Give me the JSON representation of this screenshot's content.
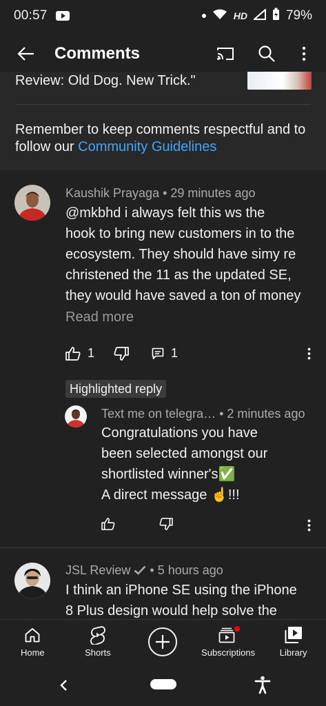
{
  "status_bar": {
    "time": "00:57",
    "network": "HD",
    "battery": "79%"
  },
  "app_bar": {
    "title": "Comments",
    "icons": [
      "back-arrow-icon",
      "cast-icon",
      "search-icon",
      "more-vert-icon"
    ]
  },
  "video": {
    "title": "Review: Old Dog. New Trick.\""
  },
  "guidelines": {
    "text": "Remember to keep comments respectful and to follow our ",
    "link": "Community Guidelines"
  },
  "comments": [
    {
      "author": "Kaushik Prayaga",
      "time": "29 minutes ago",
      "lines": [
        "@mkbhd i always felt this ws the",
        "hook to bring new customers in to the",
        "ecosystem. They should have simy re",
        "christened the 11 as the updated SE,",
        "they would have saved a ton of money"
      ],
      "read_more": "Read more",
      "likes": "1",
      "replies": "1"
    },
    {
      "badge": "Highlighted reply",
      "author": "Text me on telegra…",
      "time": "2 minutes ago",
      "lines": [
        "Congratulations you have",
        "been selected amongst our",
        "shortlisted winner's✅",
        "A direct message ☝️!!!"
      ]
    },
    {
      "author": "JSL Review",
      "verified": true,
      "time": "5 hours ago",
      "lines": [
        "I think an iPhone SE using the iPhone",
        "8 Plus design would help solve the"
      ]
    }
  ],
  "bottom_nav": {
    "items": [
      {
        "label": "Home",
        "icon": "home-icon"
      },
      {
        "label": "Shorts",
        "icon": "shorts-icon"
      },
      {
        "label": "",
        "icon": "create-icon"
      },
      {
        "label": "Subscriptions",
        "icon": "subscriptions-icon"
      },
      {
        "label": "Library",
        "icon": "library-icon"
      }
    ]
  },
  "colors": {
    "background": "#212121",
    "link": "#3ea6ff",
    "notification": "#ff0000"
  }
}
